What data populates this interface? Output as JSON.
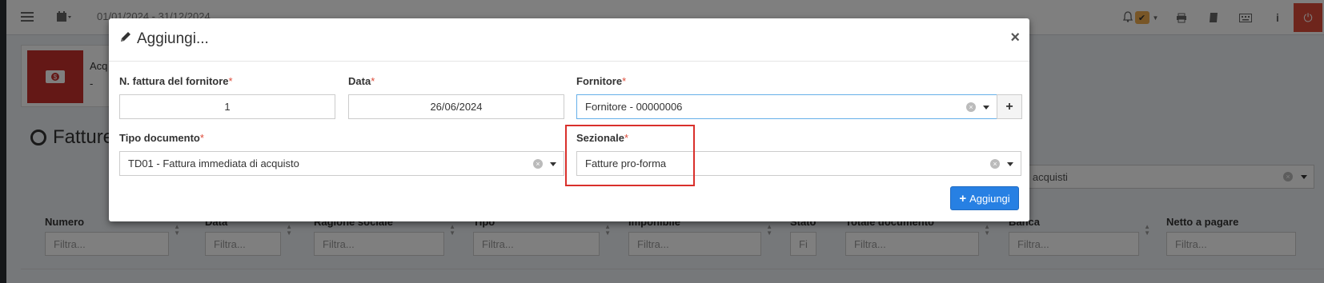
{
  "topbar": {
    "date_range": "01/01/2024 - 31/12/2024",
    "icons": [
      "menu-icon",
      "calendar-icon",
      "bell-icon",
      "check-badge-icon",
      "print-icon",
      "book-icon",
      "keyboard-icon",
      "info-icon",
      "power-icon"
    ]
  },
  "info_box": {
    "title": "Acq",
    "subtitle": "-"
  },
  "page": {
    "heading": "Fatture"
  },
  "background_select": {
    "value": "ndard acquisti"
  },
  "table": {
    "columns": [
      {
        "label": "Numero",
        "placeholder": "Filtra..."
      },
      {
        "label": "Data",
        "placeholder": "Filtra..."
      },
      {
        "label": "Ragione sociale",
        "placeholder": "Filtra..."
      },
      {
        "label": "Tipo",
        "placeholder": "Filtra..."
      },
      {
        "label": "Imponibile",
        "placeholder": "Filtra..."
      },
      {
        "label": "Stato",
        "placeholder": "Fi"
      },
      {
        "label": "Totale documento",
        "placeholder": "Filtra..."
      },
      {
        "label": "Banca",
        "placeholder": "Filtra..."
      },
      {
        "label": "Netto a pagare",
        "placeholder": "Filtra..."
      }
    ]
  },
  "modal": {
    "title": "Aggiungi...",
    "close": "×",
    "fields": {
      "n_fattura": {
        "label": "N. fattura del fornitore",
        "required": "*",
        "value": "1"
      },
      "data": {
        "label": "Data",
        "required": "*",
        "value": "26/06/2024"
      },
      "fornitore": {
        "label": "Fornitore",
        "required": "*",
        "value": "Fornitore - 00000006",
        "addon": "+"
      },
      "tipo_documento": {
        "label": "Tipo documento",
        "required": "*",
        "value": "TD01 - Fattura immediata di acquisto"
      },
      "sezionale": {
        "label": "Sezionale",
        "required": "*",
        "value": "Fatture pro-forma"
      }
    },
    "submit_label": "Aggiungi"
  },
  "colors": {
    "primary": "#2780e3",
    "danger": "#dd4b39",
    "highlight": "#d9302b",
    "warning": "#f0ad4e"
  }
}
